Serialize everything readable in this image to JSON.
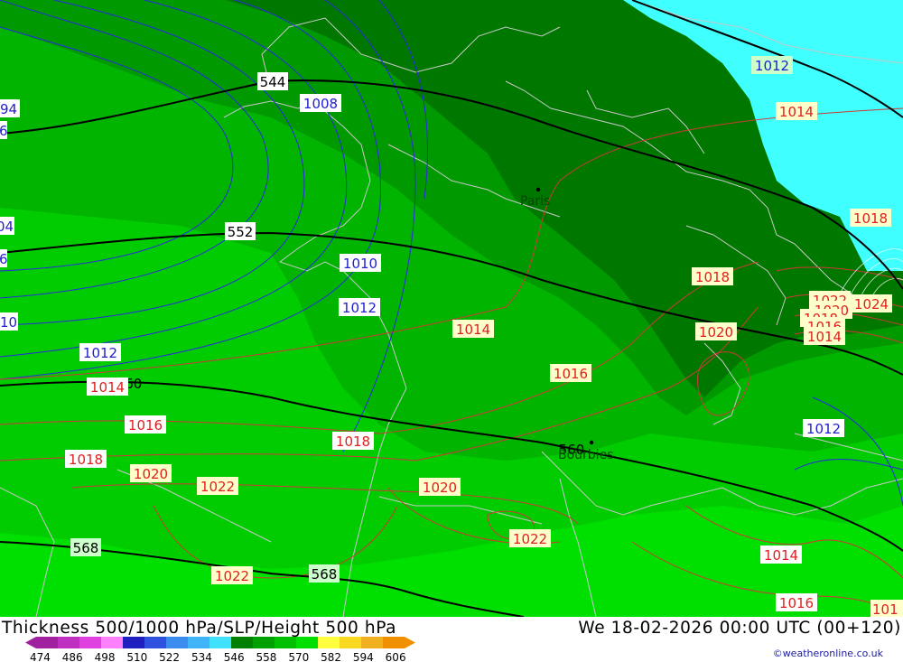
{
  "title": "Thickness 500/1000 hPa/SLP/Height 500 hPa",
  "datetime": "We 18-02-2026 00:00 UTC (00+120)",
  "credit": "©weatheronline.co.uk",
  "cities": [
    {
      "name": "Paris"
    },
    {
      "name": "Bourbies"
    }
  ],
  "thickness_labels": [
    "544",
    "552",
    "560",
    "560",
    "568",
    "568"
  ],
  "slp_blue_labels": [
    "94",
    "6",
    "04",
    "6",
    "10",
    "1008",
    "1010",
    "1012",
    "1012",
    "1012",
    "1012"
  ],
  "slp_red_labels": [
    "1014",
    "1014",
    "1018",
    "1018",
    "1014",
    "1016",
    "1018",
    "1020",
    "1016",
    "1018",
    "1020",
    "1022",
    "1022",
    "1020",
    "1022",
    "1014",
    "1016",
    "101",
    "1022",
    "1020",
    "1018",
    "1016",
    "1014",
    "1024"
  ],
  "colorbar": {
    "ticks": [
      "474",
      "486",
      "498",
      "510",
      "522",
      "534",
      "546",
      "558",
      "570",
      "582",
      "594",
      "606"
    ],
    "colors": [
      "#a020a0",
      "#c030c0",
      "#e040e0",
      "#ff80ff",
      "#2020c0",
      "#3050e0",
      "#3c8cf0",
      "#40b4f8",
      "#40e0ff",
      "#008000",
      "#00a000",
      "#00c000",
      "#00e000",
      "#ffff40",
      "#f8d820",
      "#f0b020",
      "#f09000"
    ]
  },
  "palette": {
    "ocean": "#40ffff",
    "green_dark": "#007800",
    "green_mid": "#009a00",
    "green": "#00b400",
    "green_light": "#00cc00",
    "green_bright": "#00e000",
    "thickness_line": "#000000",
    "slp_low": "#2020e0",
    "slp_high": "#e02828"
  }
}
